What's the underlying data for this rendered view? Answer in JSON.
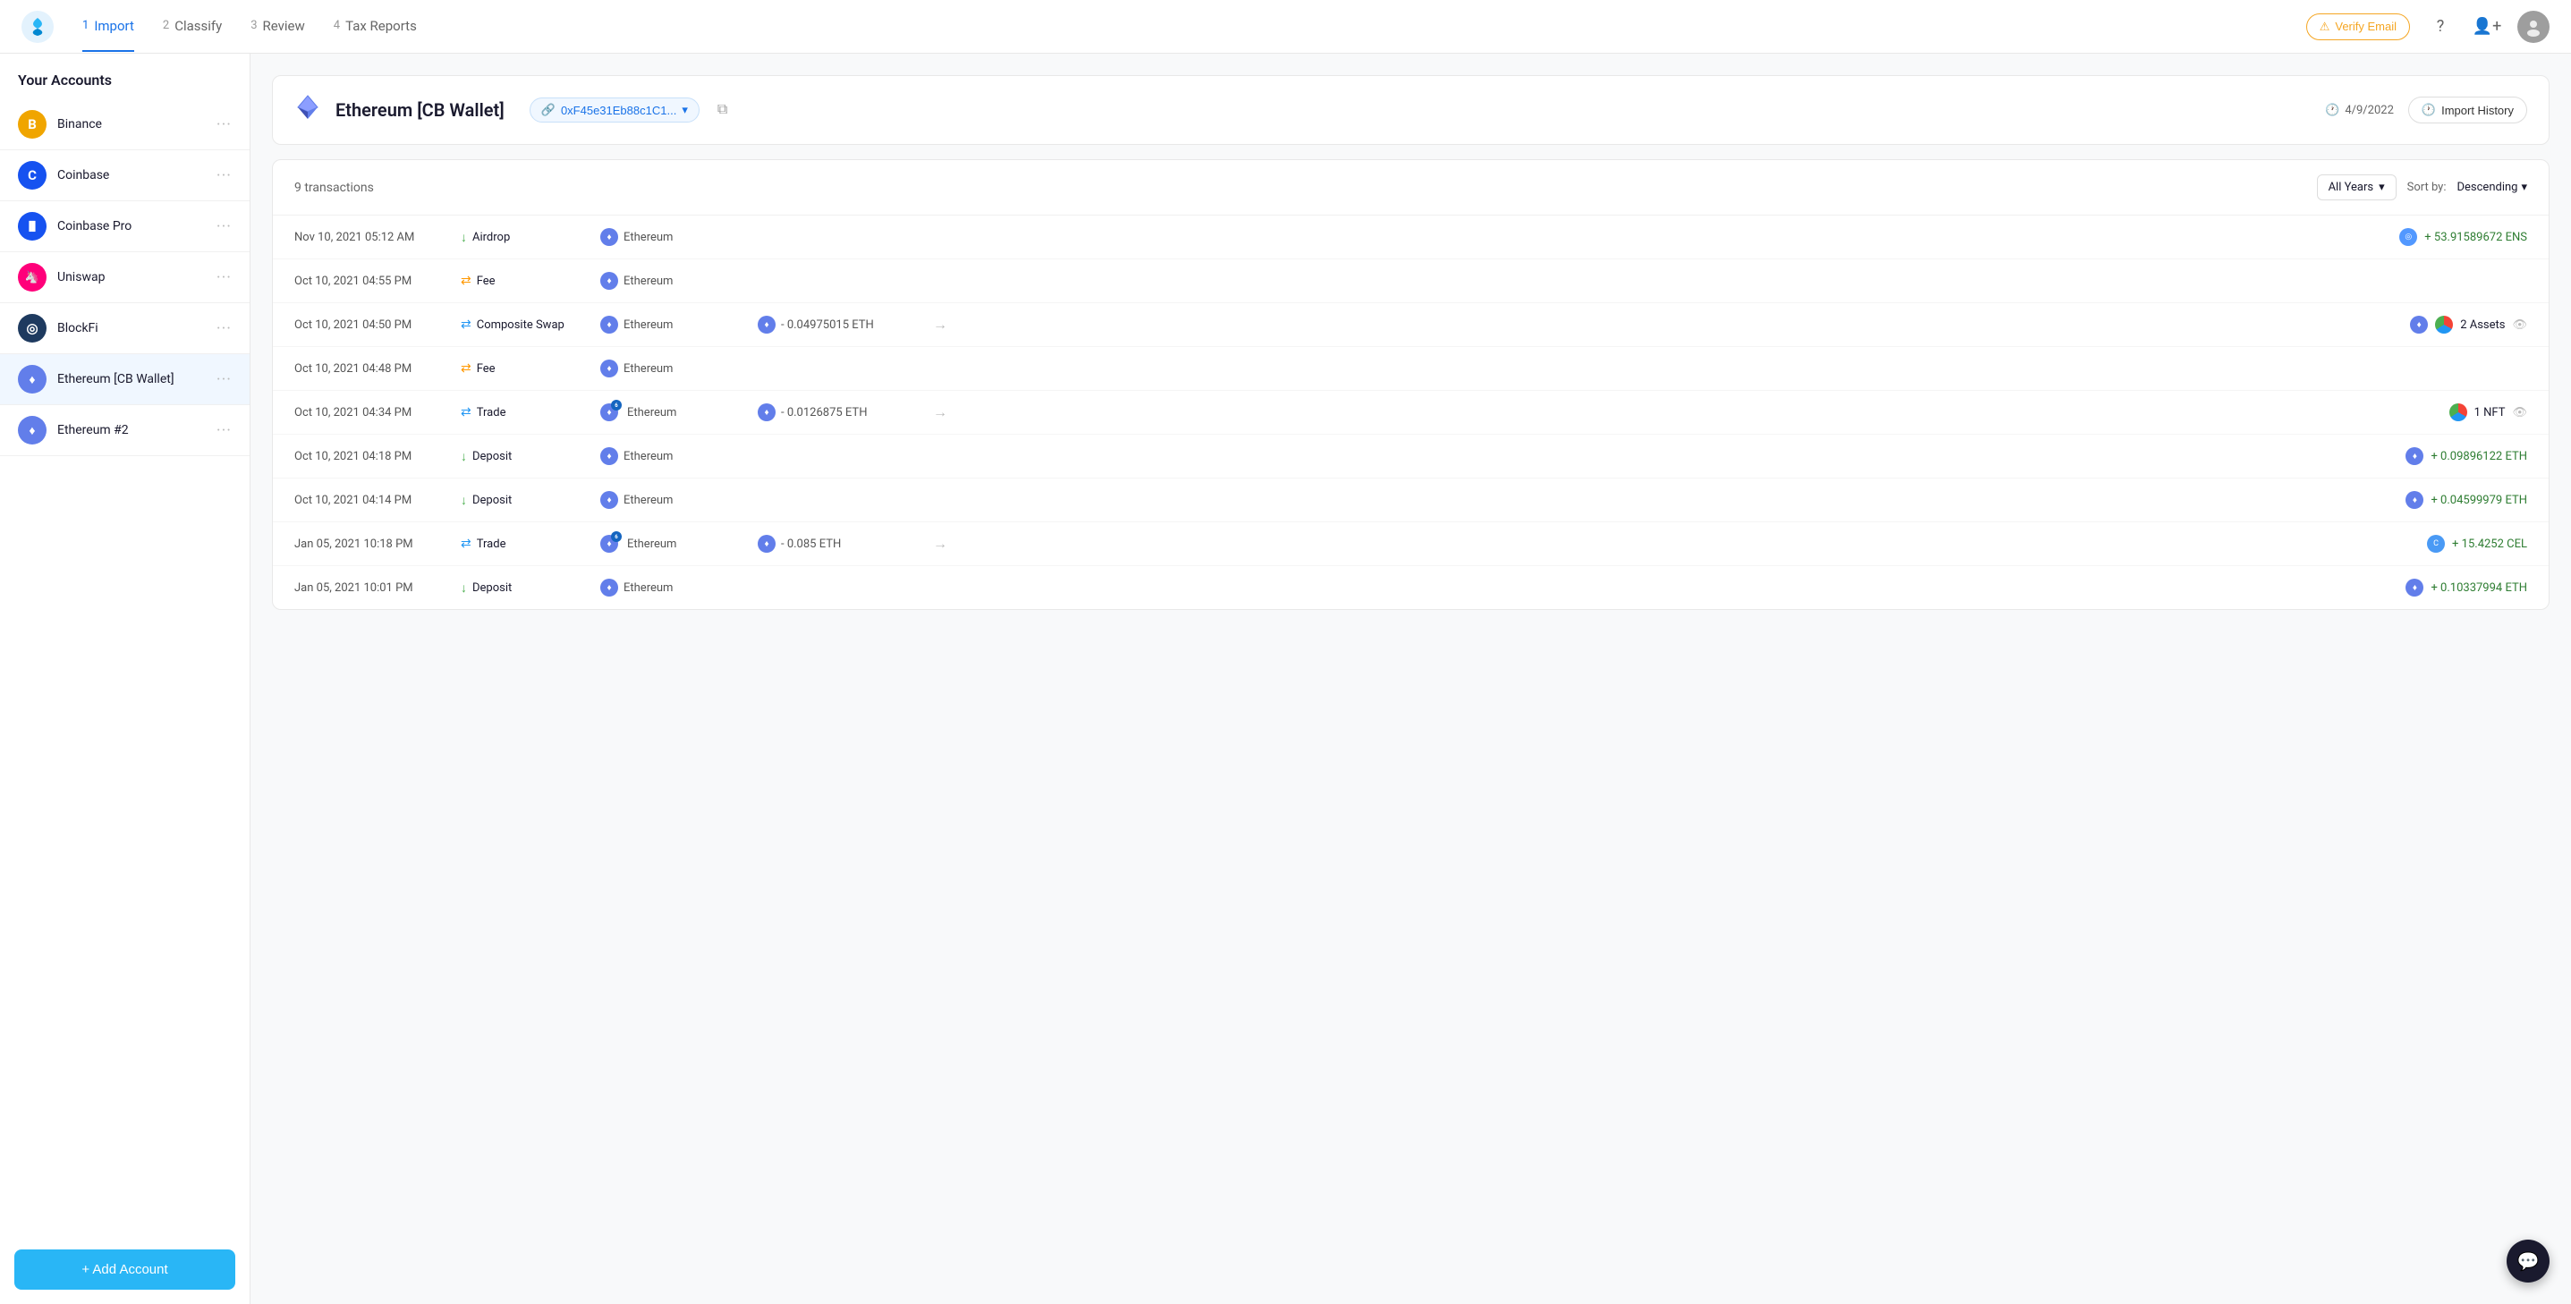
{
  "nav": {
    "steps": [
      {
        "num": "1",
        "label": "Import",
        "active": true
      },
      {
        "num": "2",
        "label": "Classify",
        "active": false
      },
      {
        "num": "3",
        "label": "Review",
        "active": false
      },
      {
        "num": "4",
        "label": "Tax Reports",
        "active": false
      }
    ],
    "verify_email_label": "Verify Email"
  },
  "sidebar": {
    "title": "Your Accounts",
    "accounts": [
      {
        "name": "Binance",
        "icon": "B",
        "icon_bg": "#f0a500",
        "active": false
      },
      {
        "name": "Coinbase",
        "icon": "C",
        "icon_bg": "#1652f0",
        "active": false
      },
      {
        "name": "Coinbase Pro",
        "icon": "||",
        "icon_bg": "#1652f0",
        "active": false
      },
      {
        "name": "Uniswap",
        "icon": "U",
        "icon_bg": "#ff007a",
        "active": false
      },
      {
        "name": "BlockFi",
        "icon": "B",
        "icon_bg": "#1e3a5f",
        "active": false
      },
      {
        "name": "Ethereum [CB Wallet]",
        "icon": "♦",
        "icon_bg": "#627eea",
        "active": true
      },
      {
        "name": "Ethereum #2",
        "icon": "♦",
        "icon_bg": "#627eea",
        "active": false
      }
    ],
    "add_account_label": "+ Add Account"
  },
  "wallet": {
    "name": "Ethereum [CB Wallet]",
    "address": "0xF45e31Eb88c1C1...",
    "date": "4/9/2022",
    "import_history_label": "Import History"
  },
  "transactions": {
    "count_label": "9 transactions",
    "year_filter": "All Years",
    "sort_label": "Sort by:",
    "sort_value": "Descending",
    "rows": [
      {
        "date": "Nov 10, 2021 05:12 AM",
        "type": "Airdrop",
        "type_class": "airdrop",
        "asset": "Ethereum",
        "has_amount": false,
        "amount": "",
        "has_arrow": false,
        "result_amount": "+ 53.91589672 ENS",
        "result_positive": true,
        "result_icon": "ens"
      },
      {
        "date": "Oct 10, 2021 04:55 PM",
        "type": "Fee",
        "type_class": "fee",
        "asset": "Ethereum",
        "has_amount": false,
        "amount": "",
        "has_arrow": false,
        "result_amount": "",
        "result_positive": false,
        "result_icon": ""
      },
      {
        "date": "Oct 10, 2021 04:50 PM",
        "type": "Composite Swap",
        "type_class": "swap",
        "asset": "Ethereum",
        "has_amount": true,
        "amount": "- 0.04975015 ETH",
        "has_arrow": true,
        "result_amount": "2 Assets",
        "result_positive": false,
        "result_icon": "pie"
      },
      {
        "date": "Oct 10, 2021 04:48 PM",
        "type": "Fee",
        "type_class": "fee",
        "asset": "Ethereum",
        "has_amount": false,
        "amount": "",
        "has_arrow": false,
        "result_amount": "",
        "result_positive": false,
        "result_icon": ""
      },
      {
        "date": "Oct 10, 2021 04:34 PM",
        "type": "Trade",
        "type_class": "trade",
        "asset": "Ethereum",
        "has_amount": true,
        "amount": "- 0.0126875 ETH",
        "has_arrow": true,
        "result_amount": "1 NFT",
        "result_positive": false,
        "result_icon": "pie"
      },
      {
        "date": "Oct 10, 2021 04:18 PM",
        "type": "Deposit",
        "type_class": "deposit",
        "asset": "Ethereum",
        "has_amount": false,
        "amount": "",
        "has_arrow": false,
        "result_amount": "+ 0.09896122 ETH",
        "result_positive": true,
        "result_icon": "eth"
      },
      {
        "date": "Oct 10, 2021 04:14 PM",
        "type": "Deposit",
        "type_class": "deposit",
        "asset": "Ethereum",
        "has_amount": false,
        "amount": "",
        "has_arrow": false,
        "result_amount": "+ 0.04599979 ETH",
        "result_positive": true,
        "result_icon": "eth"
      },
      {
        "date": "Jan 05, 2021 10:18 PM",
        "type": "Trade",
        "type_class": "trade",
        "asset": "Ethereum",
        "has_amount": true,
        "amount": "- 0.085 ETH",
        "has_arrow": true,
        "result_amount": "+ 15.4252 CEL",
        "result_positive": true,
        "result_icon": "cel"
      },
      {
        "date": "Jan 05, 2021 10:01 PM",
        "type": "Deposit",
        "type_class": "deposit",
        "asset": "Ethereum",
        "has_amount": false,
        "amount": "",
        "has_arrow": false,
        "result_amount": "+ 0.10337994 ETH",
        "result_positive": true,
        "result_icon": "eth"
      }
    ]
  }
}
